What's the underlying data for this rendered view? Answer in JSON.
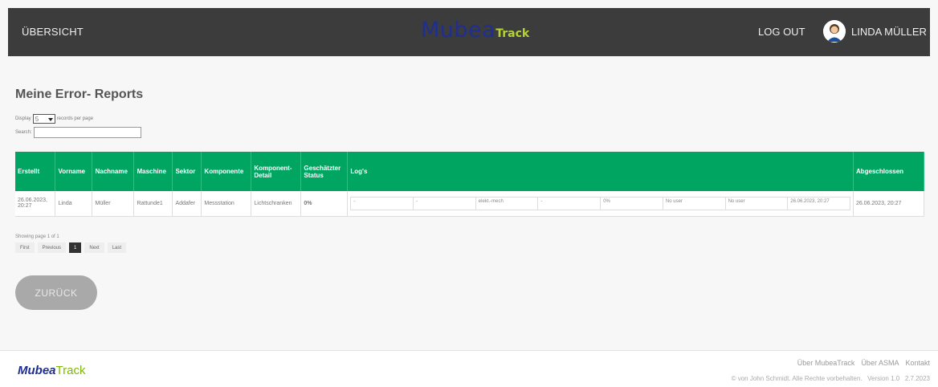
{
  "header": {
    "nav_overview": "ÜBERSICHT",
    "logo_mubea": "Mubea",
    "logo_track": "Track",
    "logout": "LOG OUT",
    "username": "LINDA MÜLLER"
  },
  "main": {
    "title": "Meine Error- Reports",
    "display_label": "Display",
    "display_value": "5",
    "display_suffix": "records per page",
    "search_label": "Search:"
  },
  "table": {
    "headers": {
      "erstellt": "Erstellt",
      "vorname": "Vorname",
      "nachname": "Nachname",
      "maschine": "Maschine",
      "sektor": "Sektor",
      "komponente": "Komponente",
      "komponent_detail": "Komponent- Detail",
      "geschaetzter_status": "Geschätzter Status",
      "logs": "Log's",
      "abgeschlossen": "Abgeschlossen"
    },
    "rows": [
      {
        "erstellt": "26.06.2023, 20:27",
        "vorname": "Linda",
        "nachname": "Müller",
        "maschine": "Rattunde1",
        "sektor": "Addafer",
        "komponente": "Messstation",
        "komponent_detail": "Lichtschranken",
        "status": "0%",
        "logs": [
          "-",
          "-",
          "elekt.-mech",
          "-",
          "0%",
          "No user",
          "No user",
          "26.06.2023, 20:27"
        ],
        "abgeschlossen": "26.06.2023, 20:27"
      }
    ]
  },
  "pagination": {
    "showing": "Showing page 1 of 1",
    "first": "First",
    "previous": "Previous",
    "current": "1",
    "next": "Next",
    "last": "Last"
  },
  "back_button": "ZURÜCK",
  "footer": {
    "logo_mubea": "Mubea",
    "logo_track": "Track",
    "link_about_mubeatrack": "Über MubeaTrack",
    "link_about_asma": "Über ASMA",
    "link_contact": "Kontakt",
    "copyright": "© von John Schmidt. Alle Rechte vorbehalten.",
    "version": "Version 1.0",
    "date": "2.7.2023"
  },
  "colors": {
    "header_bg": "#3c3c3c",
    "table_header_bg": "#00a562",
    "logo_blue": "#1f2f8f",
    "logo_green": "#b5d334",
    "status_orange": "#e08a00",
    "back_button_bg": "#a9a9a9"
  },
  "icons": {
    "avatar": "user-avatar-icon",
    "select_caret": "chevron-down-icon"
  }
}
